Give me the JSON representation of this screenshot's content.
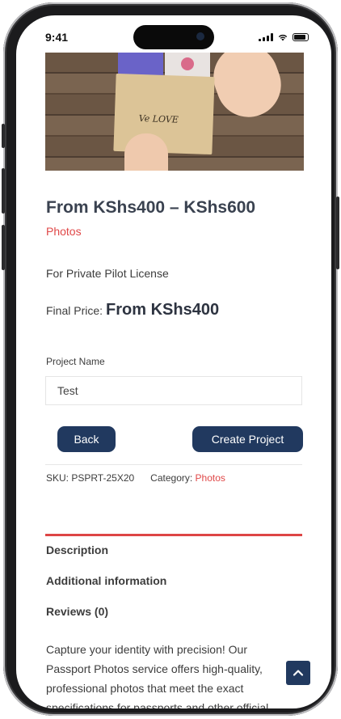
{
  "status_bar": {
    "time": "9:41"
  },
  "hero": {
    "envelope_text": "Ve LOVE"
  },
  "product": {
    "title": "From KShs400 – KShs600",
    "category_link": "Photos",
    "subtitle": "For Private Pilot License",
    "final_price_label": "Final Price:",
    "final_price_amount": "From KShs400"
  },
  "form": {
    "project_name_label": "Project Name",
    "project_name_value": "Test",
    "back_label": "Back",
    "create_label": "Create Project"
  },
  "meta": {
    "sku": "SKU: PSPRT-25X20",
    "category_label": "Category:",
    "category_value": "Photos"
  },
  "tabs": [
    {
      "label": "Description"
    },
    {
      "label": "Additional information"
    },
    {
      "label": "Reviews (0)"
    }
  ],
  "description": "Capture your identity with precision! Our Passport Photos service offers high-quality, professional photos that meet the exact specifications for passports and other official",
  "colors": {
    "accent": "#e04848",
    "button": "#21395f"
  }
}
